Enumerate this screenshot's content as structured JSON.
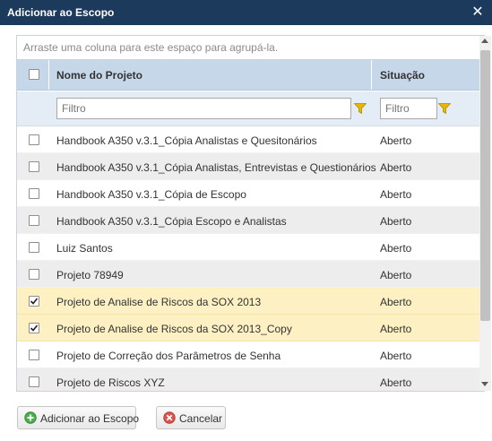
{
  "dialog": {
    "title": "Adicionar ao Escopo",
    "close_glyph": "✕"
  },
  "grid": {
    "group_panel_text": "Arraste uma coluna para este espaço para agrupá-la.",
    "columns": {
      "name": "Nome do Projeto",
      "status": "Situação"
    },
    "filters": {
      "name_placeholder": "Filtro",
      "status_placeholder": "Filtro"
    },
    "rows": [
      {
        "name": "Handbook A350 v.3.1_Cópia Analistas e Quesitonários",
        "status": "Aberto",
        "checked": false
      },
      {
        "name": "Handbook A350 v.3.1_Cópia Analistas, Entrevistas e Questionários",
        "status": "Aberto",
        "checked": false
      },
      {
        "name": "Handbook A350 v.3.1_Cópia de Escopo",
        "status": "Aberto",
        "checked": false
      },
      {
        "name": "Handbook A350 v.3.1_Cópia Escopo e Analistas",
        "status": "Aberto",
        "checked": false
      },
      {
        "name": "Luiz Santos",
        "status": "Aberto",
        "checked": false
      },
      {
        "name": "Projeto 78949",
        "status": "Aberto",
        "checked": false
      },
      {
        "name": "Projeto de Analise de Riscos da SOX 2013",
        "status": "Aberto",
        "checked": true
      },
      {
        "name": "Projeto de Analise de Riscos da SOX 2013_Copy",
        "status": "Aberto",
        "checked": true
      },
      {
        "name": "Projeto de Correção dos Parâmetros de Senha",
        "status": "Aberto",
        "checked": false
      },
      {
        "name": "Projeto de Riscos XYZ",
        "status": "Aberto",
        "checked": false
      }
    ]
  },
  "buttons": {
    "add_label": "Adicionar ao Escopo",
    "cancel_label": "Cancelar"
  },
  "icons": {
    "close": "close-icon",
    "filter": "funnel-icon",
    "add": "plus-circle-icon",
    "cancel": "x-circle-icon",
    "checkbox_checked": "checkmark-icon"
  },
  "colors": {
    "titlebar": "#1b3a5c",
    "header": "#c6d7ea",
    "filter_row": "#e4ecf5",
    "selected_row": "#fdf1c4",
    "alt_row": "#ededed",
    "funnel": "#e6b800",
    "add_icon": "#4caf50",
    "cancel_icon": "#d9534f"
  }
}
